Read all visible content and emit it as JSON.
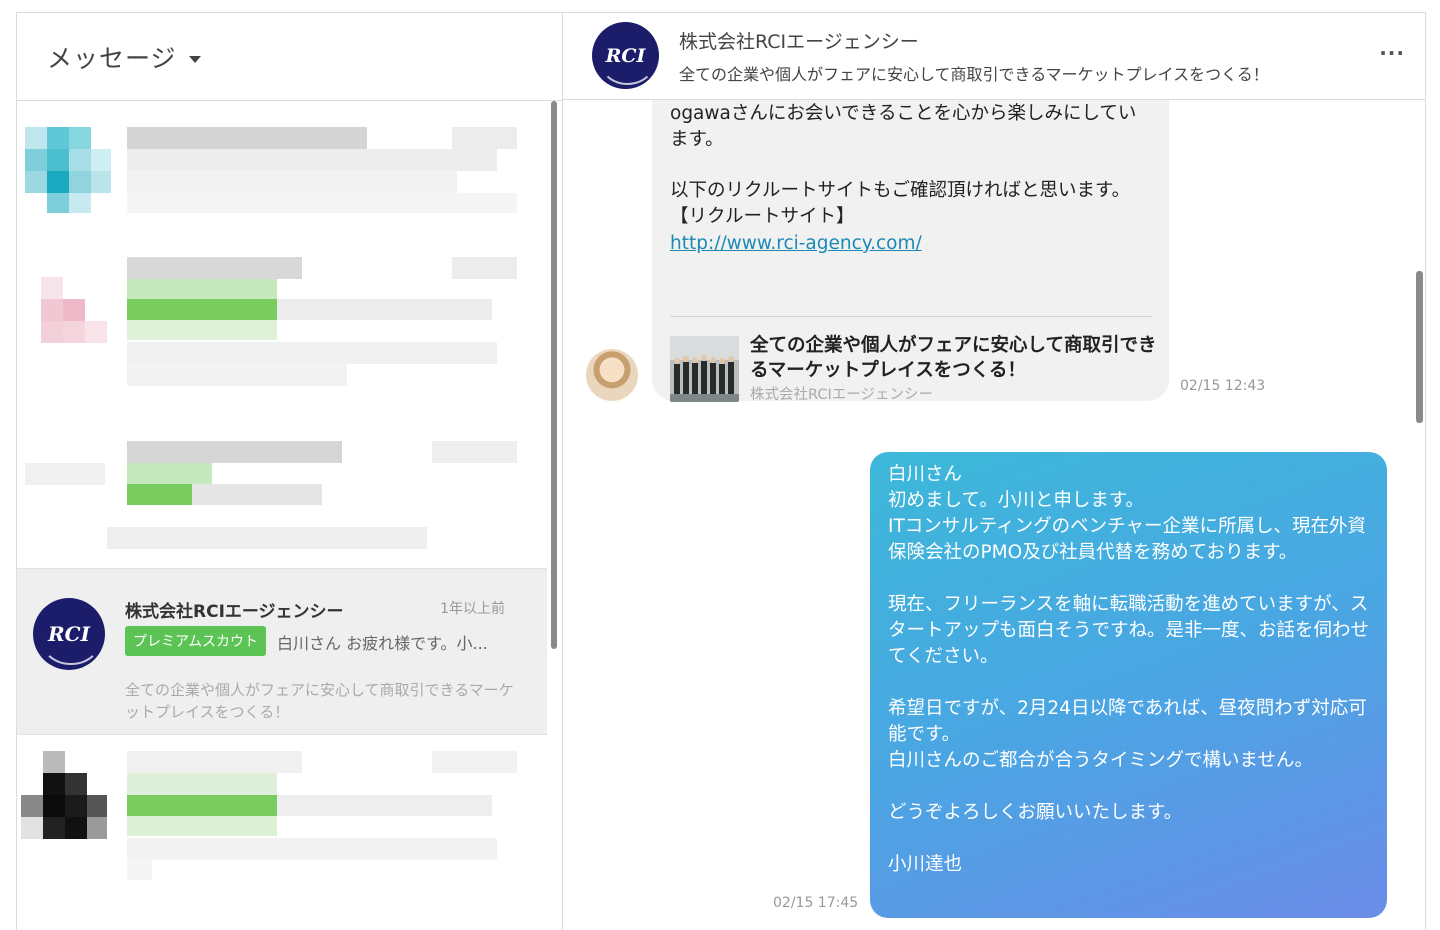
{
  "sidebar": {
    "title": "メッセージ",
    "active_item": {
      "name": "株式会社RCIエージェンシー",
      "time": "1年以上前",
      "badge": "プレミアムスカウト",
      "preview": "白川さん お疲れ様です。小...",
      "subtitle": "全ての企業や個人がフェアに安心して商取引できるマーケットプレイスをつくる！",
      "logo_text": "RCI"
    }
  },
  "conversation": {
    "header": {
      "name": "株式会社RCIエージェンシー",
      "subtitle": "全ての企業や個人がフェアに安心して商取引できるマーケットプレイスをつくる！",
      "logo_text": "RCI",
      "more_label": "···"
    },
    "incoming": {
      "line1": "ogawaさんにお会いできることを心から楽しみにしています。",
      "line2": "以下のリクルートサイトもご確認頂ければと思います。",
      "line3": "【リクルートサイト】",
      "link": "http://www.rci-agency.com/",
      "card_title": "全ての企業や個人がフェアに安心して商取引できるマーケットプレイスをつくる！",
      "card_source": "株式会社RCIエージェンシー",
      "time": "02/15 12:43"
    },
    "outgoing": {
      "p1_l1": "白川さん",
      "p1_l2": "初めまして。小川と申します。",
      "p1_l3": "ITコンサルティングのベンチャー企業に所属し、現在外資保険会社のPMO及び社員代替を務めております。",
      "p2": "現在、フリーランスを軸に転職活動を進めていますが、スタートアップも面白そうですね。是非一度、お話を伺わせてください。",
      "p3_l1": "希望日ですが、2月24日以降であれば、昼夜問わず対応可能です。",
      "p3_l2": "白川さんのご都合が合うタイミングで構いません。",
      "p4": "どうぞよろしくお願いいたします。",
      "signature": "小川達也",
      "time": "02/15 17:45"
    }
  }
}
